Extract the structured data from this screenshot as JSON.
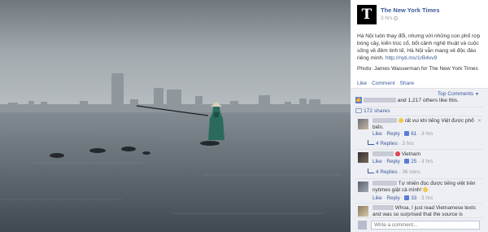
{
  "header": {
    "page_name": "The New York Times",
    "logo_letter": "T",
    "time": "3 hrs"
  },
  "post": {
    "caption": "Hà Nội luôn thay đổi, nhưng với những con phố rợp bóng cây, kiến trúc cổ, bối cảnh nghệ thuật và cuộc sống về đêm tinh tế, Hà Nội vẫn mang vẻ độc đáo riêng mình.",
    "link": "http://nyti.ms/1rB4vv9",
    "credit": "Photo: James Wasserman for The New York Times",
    "actions": [
      "Like",
      "Comment",
      "Share"
    ]
  },
  "feedback": {
    "top_comments": "Top Comments",
    "likes_text": "and 1,217 others like this.",
    "shares": "172 shares",
    "comments": [
      {
        "text_before": "",
        "text_after": "rất vui khi tiếng Việt được phổ biến.",
        "emoji": "smile",
        "like": "Like",
        "reply": "Reply",
        "likes": "61",
        "time": "3 hrs",
        "replies_label": "4 Replies",
        "replies_time": "3 hrs"
      },
      {
        "text_before": "",
        "text_after": "Vietnam",
        "emoji": "heart",
        "like": "Like",
        "reply": "Reply",
        "likes": "25",
        "time": "3 hrs",
        "replies_label": "4 Replies",
        "replies_time": "36 mins"
      },
      {
        "text_before": "",
        "text_after": "Tự nhiên đọc được tiếng việt trên nytimes giật cả mình!",
        "emoji": "smile",
        "like": "Like",
        "reply": "Reply",
        "likes": "33",
        "time": "3 hrs"
      },
      {
        "text_after": "Whoa, I just read Vietnamese texts and was so surprised that the source is"
      }
    ],
    "write_placeholder": "Write a comment..."
  },
  "colors": {
    "link": "#3b5998",
    "feedback_bg": "#edeff4",
    "photo_sky": "#8d959c",
    "photo_water": "#5a646c"
  }
}
